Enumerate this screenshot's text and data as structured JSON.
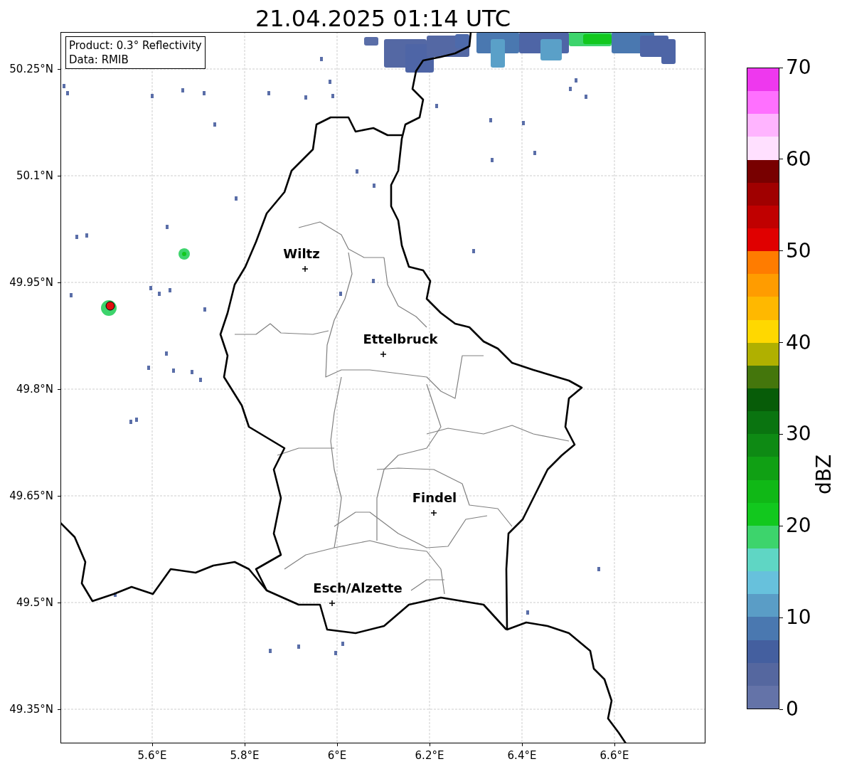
{
  "title": "21.04.2025 01:14 UTC",
  "info_box": [
    "Product: 0.3° Reflectivity",
    "Data: RMIB"
  ],
  "map": {
    "lat_ticks": [
      "50.25°N",
      "50.1°N",
      "49.95°N",
      "49.8°N",
      "49.65°N",
      "49.5°N",
      "49.35°N"
    ],
    "lon_ticks": [
      "5.6°E",
      "5.8°E",
      "6°E",
      "6.2°E",
      "6.4°E",
      "6.6°E"
    ],
    "cities": [
      {
        "name": "Wiltz"
      },
      {
        "name": "Ettelbruck"
      },
      {
        "name": "Findel"
      },
      {
        "name": "Esch/Alzette"
      }
    ]
  },
  "colorbar": {
    "label": "dBZ",
    "ticks": [
      "70",
      "60",
      "50",
      "40",
      "30",
      "20",
      "10",
      "0"
    ],
    "bands": [
      {
        "color": "#6473a8"
      },
      {
        "color": "#55679f"
      },
      {
        "color": "#445f9f"
      },
      {
        "color": "#4a78b0"
      },
      {
        "color": "#5a9dc6"
      },
      {
        "color": "#67c1dc"
      },
      {
        "color": "#5fd6c4"
      },
      {
        "color": "#3dd46c"
      },
      {
        "color": "#12c81e"
      },
      {
        "color": "#10b816"
      },
      {
        "color": "#10a014"
      },
      {
        "color": "#0e8a14"
      },
      {
        "color": "#0a7410"
      },
      {
        "color": "#075c08"
      },
      {
        "color": "#44760c"
      },
      {
        "color": "#b0b000"
      },
      {
        "color": "#ffd800"
      },
      {
        "color": "#ffb800"
      },
      {
        "color": "#ff9c00"
      },
      {
        "color": "#ff7c00"
      },
      {
        "color": "#e00000"
      },
      {
        "color": "#c00000"
      },
      {
        "color": "#a00000"
      },
      {
        "color": "#780000"
      },
      {
        "color": "#ffe0ff"
      },
      {
        "color": "#ffb4ff"
      },
      {
        "color": "#ff70ff"
      },
      {
        "color": "#ee38ee"
      }
    ]
  }
}
